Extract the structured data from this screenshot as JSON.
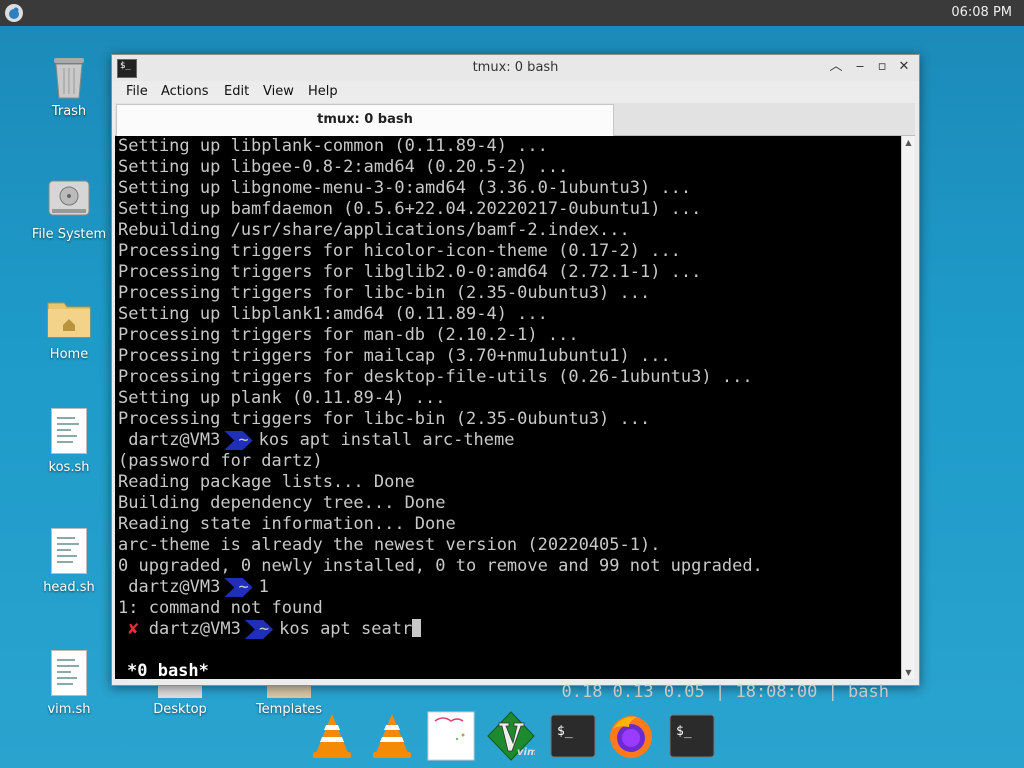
{
  "panel": {
    "clock": "06:08 PM"
  },
  "desktop": {
    "icons": [
      {
        "label": "Trash"
      },
      {
        "label": "File System"
      },
      {
        "label": "Home"
      },
      {
        "label": "kos.sh"
      },
      {
        "label": "head.sh"
      },
      {
        "label": "vim.sh"
      },
      {
        "label": "Desktop"
      },
      {
        "label": "Templates"
      }
    ]
  },
  "window": {
    "title": "tmux: 0 bash",
    "menu": [
      "File",
      "Actions",
      "Edit",
      "View",
      "Help"
    ],
    "tab_label": "tmux: 0 bash"
  },
  "terminal": {
    "lines": [
      "Setting up libplank-common (0.11.89-4) ...",
      "Setting up libgee-0.8-2:amd64 (0.20.5-2) ...",
      "Setting up libgnome-menu-3-0:amd64 (3.36.0-1ubuntu3) ...",
      "Setting up bamfdaemon (0.5.6+22.04.20220217-0ubuntu1) ...",
      "Rebuilding /usr/share/applications/bamf-2.index...",
      "Processing triggers for hicolor-icon-theme (0.17-2) ...",
      "Processing triggers for libglib2.0-0:amd64 (2.72.1-1) ...",
      "Processing triggers for libc-bin (2.35-0ubuntu3) ...",
      "Setting up libplank1:amd64 (0.11.89-4) ...",
      "Processing triggers for man-db (2.10.2-1) ...",
      "Processing triggers for mailcap (3.70+nmu1ubuntu1) ...",
      "Processing triggers for desktop-file-utils (0.26-1ubuntu3) ...",
      "Setting up plank (0.11.89-4) ...",
      "Processing triggers for libc-bin (2.35-0ubuntu3) ..."
    ],
    "prompt_user": "dartz@VM3",
    "prompt_dir": "~",
    "cmd1": "kos apt install arc-theme",
    "lines2": [
      "(password for dartz)",
      "Reading package lists... Done",
      "Building dependency tree... Done",
      "Reading state information... Done",
      "arc-theme is already the newest version (20220405-1).",
      "0 upgraded, 0 newly installed, 0 to remove and 99 not upgraded."
    ],
    "cmd2": "1",
    "error_line": "1: command not found",
    "error_mark": "✘",
    "cmd3": "kos apt seatr",
    "status_left": "*0 bash*",
    "status_right": "0.18 0.13 0.05 | 18:08:00 | bash"
  },
  "dock": {
    "items": [
      "vlc-icon",
      "vlc-icon",
      "image-viewer-icon",
      "vim-icon",
      "terminal-icon",
      "firefox-icon",
      "terminal-icon"
    ]
  }
}
